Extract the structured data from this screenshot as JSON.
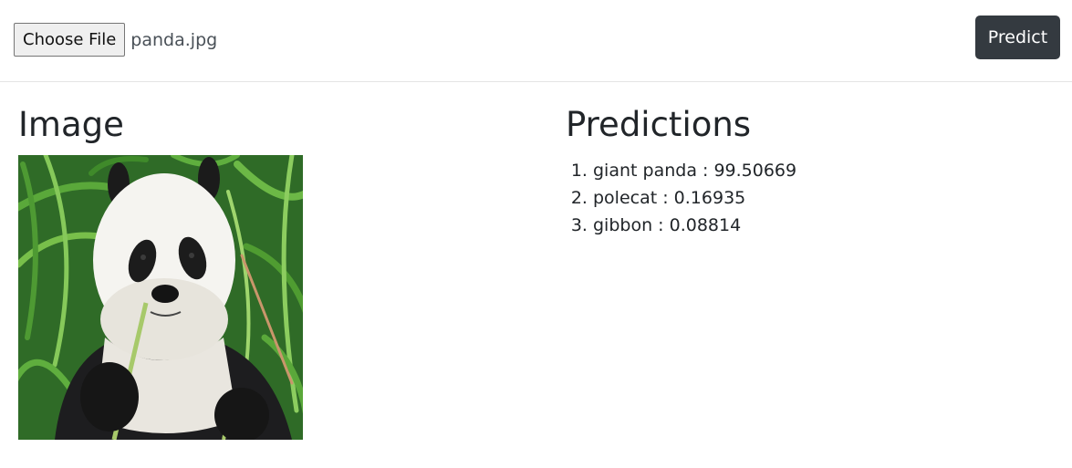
{
  "toolbar": {
    "choose_file_label": "Choose File",
    "file_name": "panda.jpg",
    "predict_label": "Predict"
  },
  "image_section": {
    "title": "Image"
  },
  "predictions_section": {
    "title": "Predictions",
    "items": [
      {
        "label": "giant panda",
        "score": "99.50669",
        "text": "giant panda : 99.50669"
      },
      {
        "label": "polecat",
        "score": "0.16935",
        "text": "polecat : 0.16935"
      },
      {
        "label": "gibbon",
        "score": "0.08814",
        "text": "gibbon : 0.08814"
      }
    ]
  },
  "colors": {
    "predict_button_bg": "#343a40",
    "text": "#212529",
    "divider": "#e4e4e4"
  }
}
